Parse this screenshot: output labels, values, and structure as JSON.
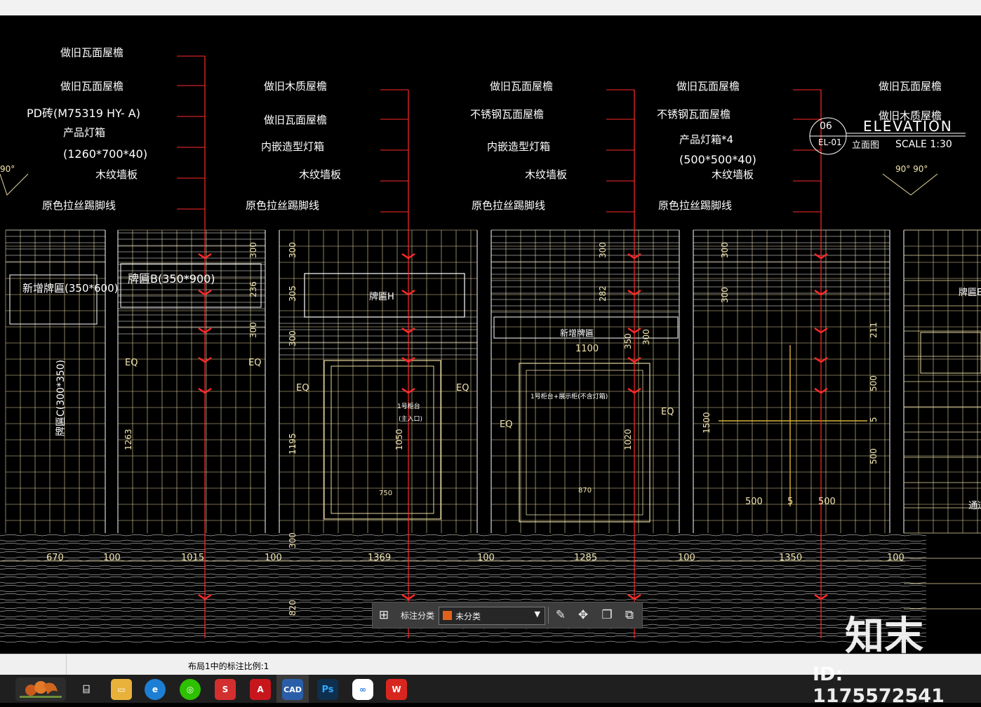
{
  "drawing": {
    "labels_col1": [
      "做旧瓦面屋檐",
      "做旧瓦面屋檐",
      "PD砖(M75319 HY- A)",
      "产品灯箱",
      "(1260*700*40)",
      "木纹墙板",
      "原色拉丝踢脚线"
    ],
    "labels_col2": [
      "做旧木质屋檐",
      "做旧瓦面屋檐",
      "内嵌造型灯箱",
      "木纹墙板",
      "原色拉丝踢脚线"
    ],
    "labels_col3": [
      "做旧瓦面屋檐",
      "不锈钢瓦面屋檐",
      "内嵌造型灯箱",
      "木纹墙板",
      "原色拉丝踢脚线"
    ],
    "labels_col4": [
      "做旧瓦面屋檐",
      "不锈钢瓦面屋檐",
      "产品灯箱*4",
      "(500*500*40)",
      "木纹墙板",
      "原色拉丝踢脚线"
    ],
    "labels_col5": [
      "做旧瓦面屋檐",
      "做旧木质屋檐"
    ],
    "title_block": {
      "num": "06",
      "code": "EL-01",
      "title": "ELEVATION",
      "subtitle": "立面图",
      "scale": "SCALE 1:30"
    },
    "angle_left": "90°",
    "angle_right": "90° 90°",
    "signs": {
      "sign1": "新增牌匾(350*600)",
      "sign2": "牌匾B(350*900)",
      "sign3": "牌匾H",
      "sign4": "新增牌匾",
      "sign5": "牌匾E",
      "vertical_sign": "牌匾C(300*350)"
    },
    "inner_texts": {
      "cabinet": "1号柜台",
      "cabinet_sub": "(主入口)",
      "frame": "1号柜台+展示柜(不含灯箱)",
      "right_partial": "通道"
    },
    "eq": "EQ",
    "dims_bottom": [
      "670",
      "100",
      "1015",
      "100",
      "1369",
      "100",
      "1285",
      "100",
      "1350",
      "100"
    ],
    "dims_inner": [
      "1100",
      "870",
      "750",
      "500",
      "5",
      "500"
    ],
    "dims_vertical": [
      "300",
      "236",
      "300",
      "300",
      "305",
      "300",
      "1263",
      "1195",
      "1050",
      "300",
      "282",
      "350",
      "300",
      "1020",
      "300",
      "300",
      "1500",
      "211",
      "500",
      "5",
      "500",
      "300",
      "820"
    ]
  },
  "toolbar": {
    "label": "标注分类",
    "selected": "未分类"
  },
  "status": {
    "text": "布局1中的标注比例:1"
  },
  "taskbar": {
    "icons": [
      "squirrel-logo",
      "task-view-icon",
      "file-explorer-icon",
      "ie-browser-icon",
      "wechat-icon",
      "sketchup-icon",
      "autocad-icon",
      "cad-viewer-icon",
      "photoshop-icon",
      "baidu-netdisk-icon",
      "wps-icon"
    ],
    "cad": "CAD",
    "ps": "Ps"
  },
  "watermark": {
    "logo": "知末",
    "id": "ID: 1175572541"
  },
  "colors": {
    "grid": "#e6d9a0",
    "leader": "#ff2a2a",
    "background": "#000000",
    "toolbar": "#3c3c3c",
    "swatch": "#e0621a"
  }
}
